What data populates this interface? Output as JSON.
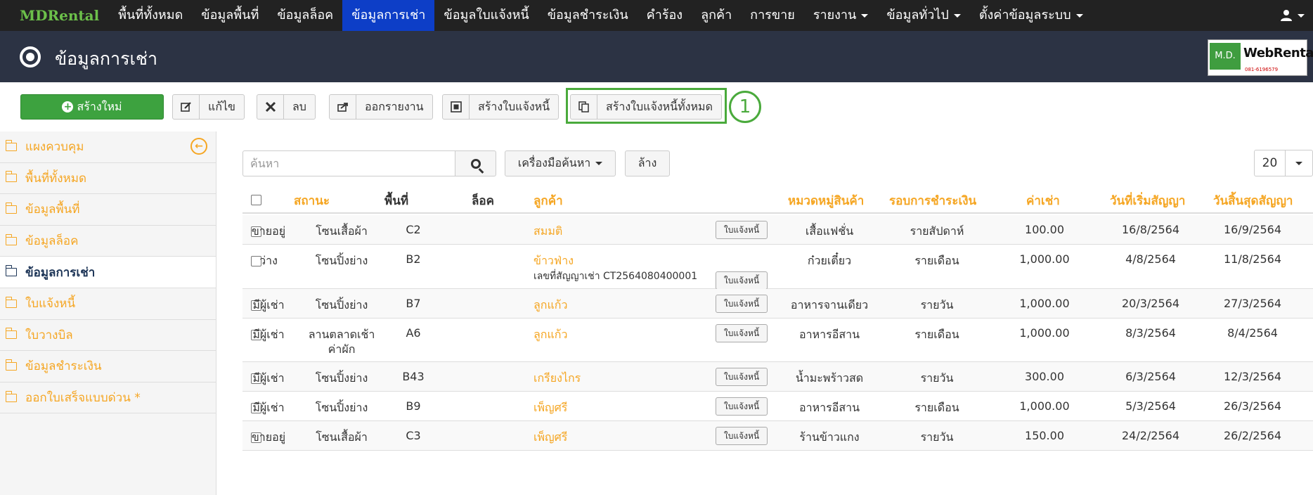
{
  "nav": {
    "brand": "MDRental",
    "items": [
      {
        "label": "พื้นที่ทั้งหมด",
        "active": false,
        "dropdown": false
      },
      {
        "label": "ข้อมูลพื้นที่",
        "active": false,
        "dropdown": false
      },
      {
        "label": "ข้อมูลล็อค",
        "active": false,
        "dropdown": false
      },
      {
        "label": "ข้อมูลการเช่า",
        "active": true,
        "dropdown": false
      },
      {
        "label": "ข้อมูลใบแจ้งหนี้",
        "active": false,
        "dropdown": false
      },
      {
        "label": "ข้อมูลชำระเงิน",
        "active": false,
        "dropdown": false
      },
      {
        "label": "คำร้อง",
        "active": false,
        "dropdown": false
      },
      {
        "label": "ลูกค้า",
        "active": false,
        "dropdown": false
      },
      {
        "label": "การขาย",
        "active": false,
        "dropdown": false
      },
      {
        "label": "รายงาน",
        "active": false,
        "dropdown": true
      },
      {
        "label": "ข้อมูลทั่วไป",
        "active": false,
        "dropdown": true
      },
      {
        "label": "ตั้งค่าข้อมูลระบบ",
        "active": false,
        "dropdown": true
      }
    ],
    "user_icon": "user-icon"
  },
  "header": {
    "title": "ข้อมูลการเช่า",
    "logo": {
      "md": "M.D.",
      "web": "WebRental",
      "phone": "081-6196579"
    }
  },
  "toolbar": {
    "create": "สร้างใหม่",
    "edit": "แก้ไข",
    "delete": "ลบ",
    "export": "ออกรายงาน",
    "create_invoice": "สร้างใบแจ้งหนี้",
    "create_all_invoices": "สร้างใบแจ้งหนี้ทั้งหมด",
    "step_badge": "1"
  },
  "sidebar": {
    "items": [
      {
        "label": "แผงควบคุม",
        "active": false
      },
      {
        "label": "พื้นที่ทั้งหมด",
        "active": false
      },
      {
        "label": "ข้อมูลพื้นที่",
        "active": false
      },
      {
        "label": "ข้อมูลล็อค",
        "active": false
      },
      {
        "label": "ข้อมูลการเช่า",
        "active": true
      },
      {
        "label": "ใบแจ้งหนี้",
        "active": false
      },
      {
        "label": "ใบวางบิล",
        "active": false
      },
      {
        "label": "ข้อมูลชำระเงิน",
        "active": false
      },
      {
        "label": "ออกใบเสร็จแบบด่วน *",
        "active": false
      }
    ]
  },
  "search": {
    "placeholder": "ค้นหา",
    "value": "",
    "tools": "เครื่องมือค้นหา",
    "clear": "ล้าง",
    "page_size": "20"
  },
  "table": {
    "headers": {
      "status": "สถานะ",
      "area": "พื้นที่",
      "lock": "ล็อค",
      "customer": "ลูกค้า",
      "category": "หมวดหมู่สินค้า",
      "cycle": "รอบการชำระเงิน",
      "rent": "ค่าเช่า",
      "start": "วันที่เริ่มสัญญา",
      "end": "วันสิ้นสุดสัญญา"
    },
    "invoice_label": "ใบแจ้งหนี้",
    "rows": [
      {
        "status": "ขายอยู่",
        "area": "โซนเสื้อผ้า",
        "area2": "",
        "lock": "C2",
        "customer": "สมมติ",
        "sub": "",
        "category": "เสื้อแฟชั่น",
        "cycle": "รายสัปดาห์",
        "rent": "100.00",
        "start": "16/8/2564",
        "end": "16/9/2564"
      },
      {
        "status": "ว่าง",
        "area": "โซนปิ้งย่าง",
        "area2": "",
        "lock": "B2",
        "customer": "ข้าวฟ่าง",
        "sub": "เลขที่สัญญาเช่า CT2564080400001",
        "category": "ก๋วยเตี๋ยว",
        "cycle": "รายเดือน",
        "rent": "1,000.00",
        "start": "4/8/2564",
        "end": "11/8/2564"
      },
      {
        "status": "มีผู้เช่า",
        "area": "โซนปิ้งย่าง",
        "area2": "",
        "lock": "B7",
        "customer": "ลูกแก้ว",
        "sub": "",
        "category": "อาหารจานเดียว",
        "cycle": "รายวัน",
        "rent": "1,000.00",
        "start": "20/3/2564",
        "end": "27/3/2564"
      },
      {
        "status": "มีผู้เช่า",
        "area": "ลานตลาดเช้า",
        "area2": "ค่าผัก",
        "lock": "A6",
        "customer": "ลูกแก้ว",
        "sub": "",
        "category": "อาหารอีสาน",
        "cycle": "รายเดือน",
        "rent": "1,000.00",
        "start": "8/3/2564",
        "end": "8/4/2564"
      },
      {
        "status": "มีผู้เช่า",
        "area": "โซนปิ้งย่าง",
        "area2": "",
        "lock": "B43",
        "customer": "เกรียงไกร",
        "sub": "",
        "category": "น้ำมะพร้าวสด",
        "cycle": "รายวัน",
        "rent": "300.00",
        "start": "6/3/2564",
        "end": "12/3/2564"
      },
      {
        "status": "มีผู้เช่า",
        "area": "โซนปิ้งย่าง",
        "area2": "",
        "lock": "B9",
        "customer": "เพ็ญศรี",
        "sub": "",
        "category": "อาหารอีสาน",
        "cycle": "รายเดือน",
        "rent": "1,000.00",
        "start": "5/3/2564",
        "end": "26/3/2564"
      },
      {
        "status": "ขายอยู่",
        "area": "โซนเสื้อผ้า",
        "area2": "",
        "lock": "C3",
        "customer": "เพ็ญศรี",
        "sub": "",
        "category": "ร้านข้าวแกง",
        "cycle": "รายวัน",
        "rent": "150.00",
        "start": "24/2/2564",
        "end": "26/2/2564"
      }
    ]
  },
  "colors": {
    "accent_orange": "#f5a623",
    "active_nav": "#0d3ec7",
    "create_green": "#3da23f",
    "highlight_green": "#4aaa3c"
  }
}
